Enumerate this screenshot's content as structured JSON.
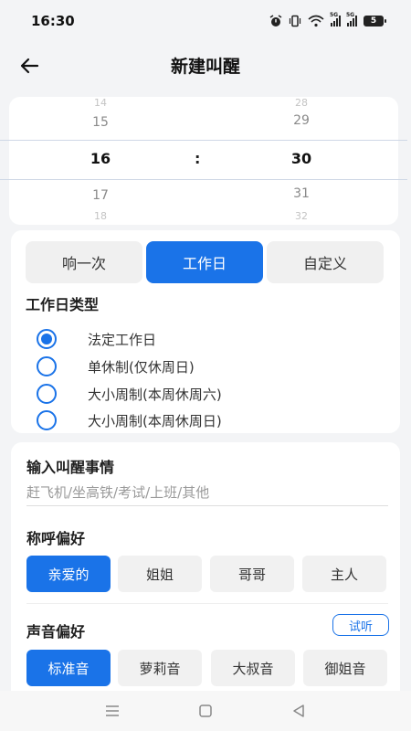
{
  "status": {
    "time": "16:30",
    "battery": "5",
    "network": "5G"
  },
  "header": {
    "title": "新建叫醒"
  },
  "picker": {
    "hours": [
      "14",
      "15",
      "16",
      "17",
      "18"
    ],
    "minutes": [
      "28",
      "29",
      "30",
      "31",
      "32"
    ],
    "separator": ":"
  },
  "repeat": {
    "options": [
      "响一次",
      "工作日",
      "自定义"
    ],
    "selected": "工作日"
  },
  "workday": {
    "title": "工作日类型",
    "options": [
      "法定工作日",
      "单休制(仅休周日)",
      "大小周制(本周休周六)",
      "大小周制(本周休周日)"
    ],
    "selected": "法定工作日"
  },
  "wake_event": {
    "title": "输入叫醒事情",
    "placeholder": "赶飞机/坐高铁/考试/上班/其他",
    "value": ""
  },
  "salutation": {
    "title": "称呼偏好",
    "options": [
      "亲爱的",
      "姐姐",
      "哥哥",
      "主人"
    ],
    "selected": "亲爱的"
  },
  "voice": {
    "title": "声音偏好",
    "try_label": "试听",
    "options": [
      "标准音",
      "萝莉音",
      "大叔音",
      "御姐音"
    ],
    "selected": "标准音"
  },
  "colors": {
    "accent": "#1a73e8",
    "background": "#f3f4f6",
    "card": "#ffffff"
  },
  "icons": {
    "back": "arrow-left-icon",
    "nav": [
      "menu-icon",
      "home-square-icon",
      "back-triangle-icon"
    ]
  }
}
